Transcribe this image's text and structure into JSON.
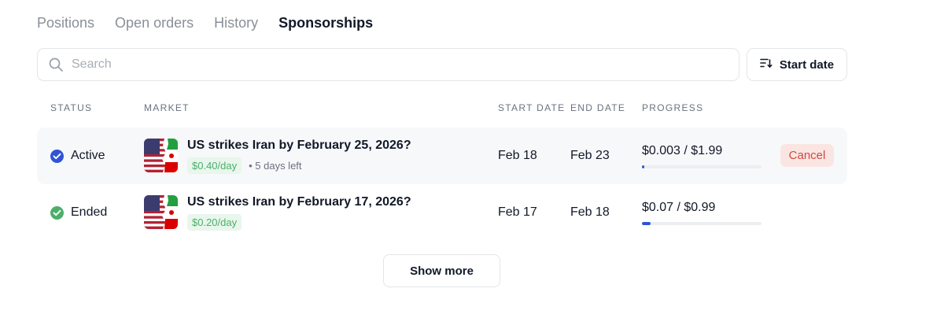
{
  "tabs": [
    {
      "label": "Positions"
    },
    {
      "label": "Open orders"
    },
    {
      "label": "History"
    },
    {
      "label": "Sponsorships",
      "active": true
    }
  ],
  "search": {
    "placeholder": "Search"
  },
  "sort": {
    "label": "Start date",
    "icon": "sort-descending-icon"
  },
  "table": {
    "headers": {
      "status": "Status",
      "market": "Market",
      "start_date": "Start date",
      "end_date": "End date",
      "progress": "Progress"
    },
    "rows": [
      {
        "status": "Active",
        "status_color": "#2f54d8",
        "market": "US strikes Iran by February 25, 2026?",
        "rate": "$0.40/day",
        "days_left": "• 5 days left",
        "start": "Feb 18",
        "end": "Feb 23",
        "progress_text": "$0.003 / $1.99",
        "progress_fraction": 0.0015,
        "action": "Cancel"
      },
      {
        "status": "Ended",
        "status_color": "#4caf6b",
        "market": "US strikes Iran by February 17, 2026?",
        "rate": "$0.20/day",
        "start": "Feb 17",
        "end": "Feb 18",
        "progress_text": "$0.07 / $0.99",
        "progress_fraction": 0.0707
      }
    ]
  },
  "show_more": {
    "label": "Show more"
  },
  "colors": {
    "accent": "#2f54d8",
    "success": "#4caf6b",
    "danger": "#d04b40"
  }
}
